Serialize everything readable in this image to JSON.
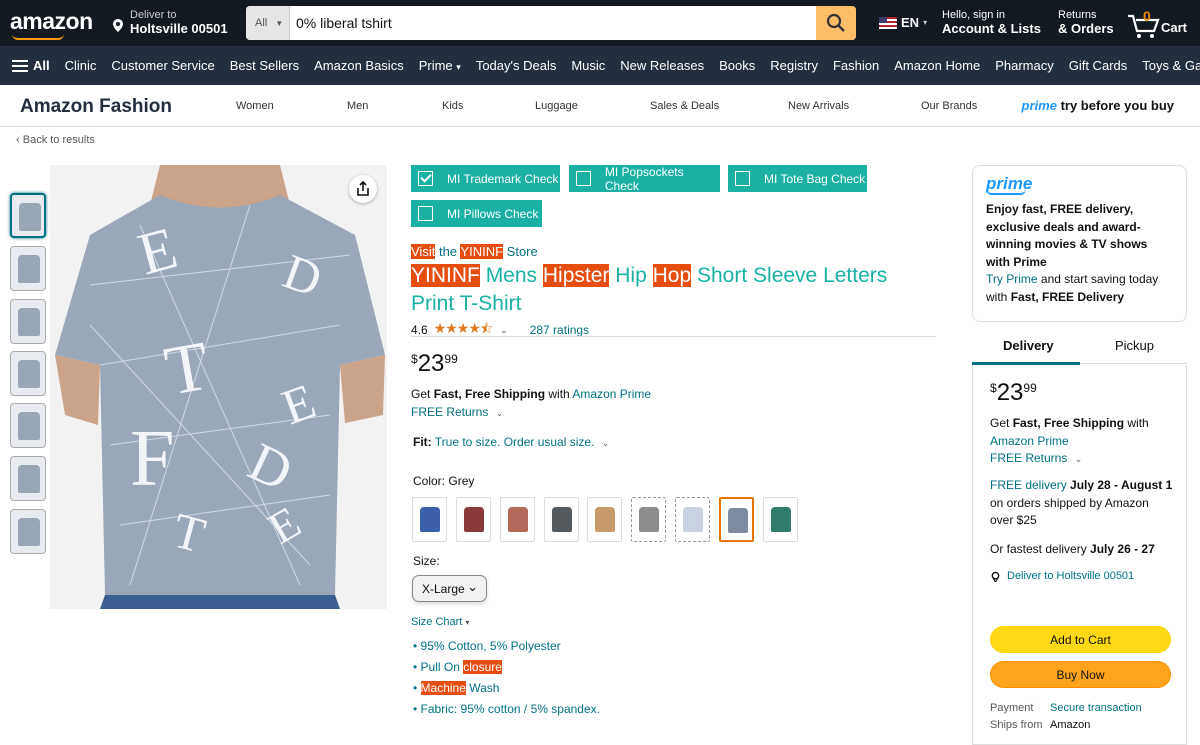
{
  "header": {
    "logo": "amazon",
    "deliver_line1": "Deliver to",
    "deliver_line2": "Holtsville 00501",
    "search_category": "All",
    "search_value": "0% liberal tshirt",
    "lang": "EN",
    "account_line1": "Hello, sign in",
    "account_line2": "Account & Lists",
    "returns_line1": "Returns",
    "returns_line2": "& Orders",
    "cart_count": "0",
    "cart_label": "Cart"
  },
  "subnav": {
    "all": "All",
    "items": [
      "Clinic",
      "Customer Service",
      "Best Sellers",
      "Amazon Basics",
      "Prime",
      "Today's Deals",
      "Music",
      "New Releases",
      "Books",
      "Registry",
      "Fashion",
      "Amazon Home",
      "Pharmacy",
      "Gift Cards",
      "Toys & Games"
    ]
  },
  "fashion_bar": {
    "brand": "Amazon Fashion",
    "links": [
      "Women",
      "Men",
      "Kids",
      "Luggage",
      "Sales & Deals",
      "New Arrivals",
      "Our Brands"
    ],
    "prime_word": "prime",
    "prime_tagline": "try before you buy"
  },
  "back_link": "Back to results",
  "checks": [
    {
      "label": "MI Trademark Check",
      "checked": true
    },
    {
      "label": "MI Popsockets Check",
      "checked": false
    },
    {
      "label": "MI Tote Bag Check",
      "checked": false
    },
    {
      "label": "MI Pillows Check",
      "checked": false
    }
  ],
  "product": {
    "store_visit": "Visit",
    "store_the": "the",
    "store_name": "YININF",
    "store_suffix": "Store",
    "title_parts": [
      "YININF",
      "Mens",
      "Hipster",
      "Hip",
      "Hop",
      "Short Sleeve Letters Print T-Shirt"
    ],
    "rating_value": "4.6",
    "stars": "★★★★⯪",
    "rating_count": "287 ratings",
    "price_symbol": "$",
    "price_whole": "23",
    "price_fraction": "99",
    "ship_prefix": "Get",
    "ship_bold": "Fast, Free Shipping",
    "ship_with": "with",
    "ship_link": "Amazon Prime",
    "free_returns": "FREE Returns",
    "fit_label": "Fit:",
    "fit_value": "True to size. Order usual size.",
    "color_label": "Color:",
    "color_value": "Grey",
    "size_label": "Size:",
    "size_value": "X-Large",
    "size_chart": "Size Chart",
    "bullet1": "95% Cotton, 5% Polyester",
    "bullet2_a": "Pull On",
    "bullet2_b": "closure",
    "bullet3_a": "Machine",
    "bullet3_b": "Wash",
    "bullet4": "Fabric: 95% cotton / 5% spandex."
  },
  "swatch_colors": [
    "#3b5fa8",
    "#8a3a3a",
    "#b46a5a",
    "#555a5f",
    "#c89a6a",
    "#8c8c8c",
    "#c9d2e0",
    "#7d8aa0",
    "#2f7d6a"
  ],
  "prime_box": {
    "logo": "prime",
    "text1": "Enjoy fast, FREE delivery, exclusive deals and award-winning movies & TV shows with Prime",
    "try_link": "Try Prime",
    "text2": "and start saving today with",
    "text2_bold": "Fast, FREE Delivery"
  },
  "buybox": {
    "tab_delivery": "Delivery",
    "tab_pickup": "Pickup",
    "ship_prefix": "Get",
    "ship_bold": "Fast, Free Shipping",
    "ship_with": "with",
    "ship_link": "Amazon Prime",
    "free_returns": "FREE Returns",
    "free_delivery": "FREE delivery",
    "delivery_dates": "July 28 - August 1",
    "delivery_suffix": "on orders shipped by Amazon over $25",
    "fastest_prefix": "Or fastest delivery",
    "fastest_dates": "July 26 - 27",
    "address": "Deliver to Holtsville 00501",
    "add_to_cart": "Add to Cart",
    "buy_now": "Buy Now",
    "payment_label": "Payment",
    "payment_value": "Secure transaction",
    "ships_from_label": "Ships from",
    "ships_from_value": "Amazon"
  }
}
